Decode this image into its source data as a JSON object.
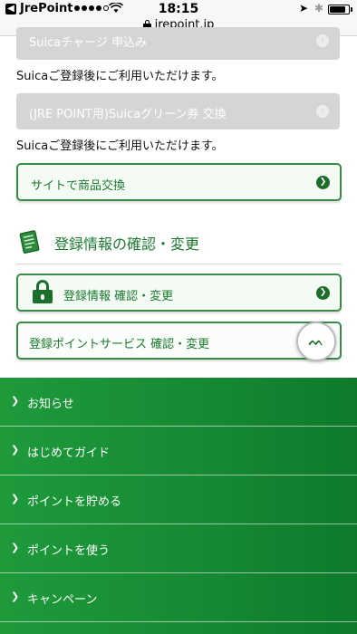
{
  "status_bar": {
    "carrier": "JrePoint",
    "time": "18:15",
    "url": "jrepoint.jp",
    "battery_level": 0.85
  },
  "disabled_buttons": [
    {
      "label": "Suicaチャージ 申込み"
    },
    {
      "label": "(JRE POINT用)Suicaグリーン券 交換"
    }
  ],
  "notes": [
    "Suicaご登録後にご利用いただけます。",
    "Suicaご登録後にご利用いただけます。"
  ],
  "site_exchange": {
    "label": "サイトで商品交換"
  },
  "section": {
    "title": "登録情報の確認・変更"
  },
  "registration_info": {
    "label": "登録情報 確認・変更"
  },
  "registered_services": {
    "label": "登録ポイントサービス 確認・変更"
  },
  "footer_nav": [
    {
      "label": "お知らせ"
    },
    {
      "label": "はじめてガイド"
    },
    {
      "label": "ポイントを貯める"
    },
    {
      "label": "ポイントを使う"
    },
    {
      "label": "キャンペーン"
    }
  ],
  "colors": {
    "brand_green": "#1d6e2a",
    "nav_green": "#178a34",
    "disabled_gray": "#d5d5d5"
  },
  "icons": {
    "back": "back-arrow-icon",
    "lock": "lock-icon",
    "document": "document-icon",
    "chevron": "chevron-right-icon"
  }
}
